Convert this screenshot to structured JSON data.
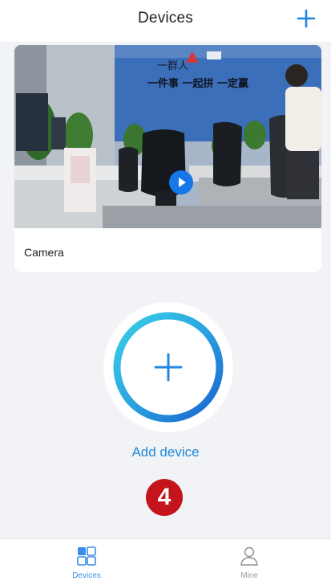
{
  "header": {
    "title": "Devices",
    "add_icon": "plus-icon"
  },
  "device_card": {
    "name": "Camera",
    "play_icon": "play-icon",
    "wall_banner_lines": [
      "一群人",
      "一件事 一起拼 一定赢"
    ]
  },
  "add_device": {
    "label": "Add device",
    "icon": "plus-icon"
  },
  "step_badge": {
    "value": "4"
  },
  "bottom_nav": {
    "items": [
      {
        "label": "Devices",
        "icon": "devices-grid-icon",
        "active": true
      },
      {
        "label": "Mine",
        "icon": "person-icon",
        "active": false
      }
    ]
  },
  "colors": {
    "accent": "#2289d9",
    "badge": "#c4151c",
    "background": "#f2f3f6"
  }
}
